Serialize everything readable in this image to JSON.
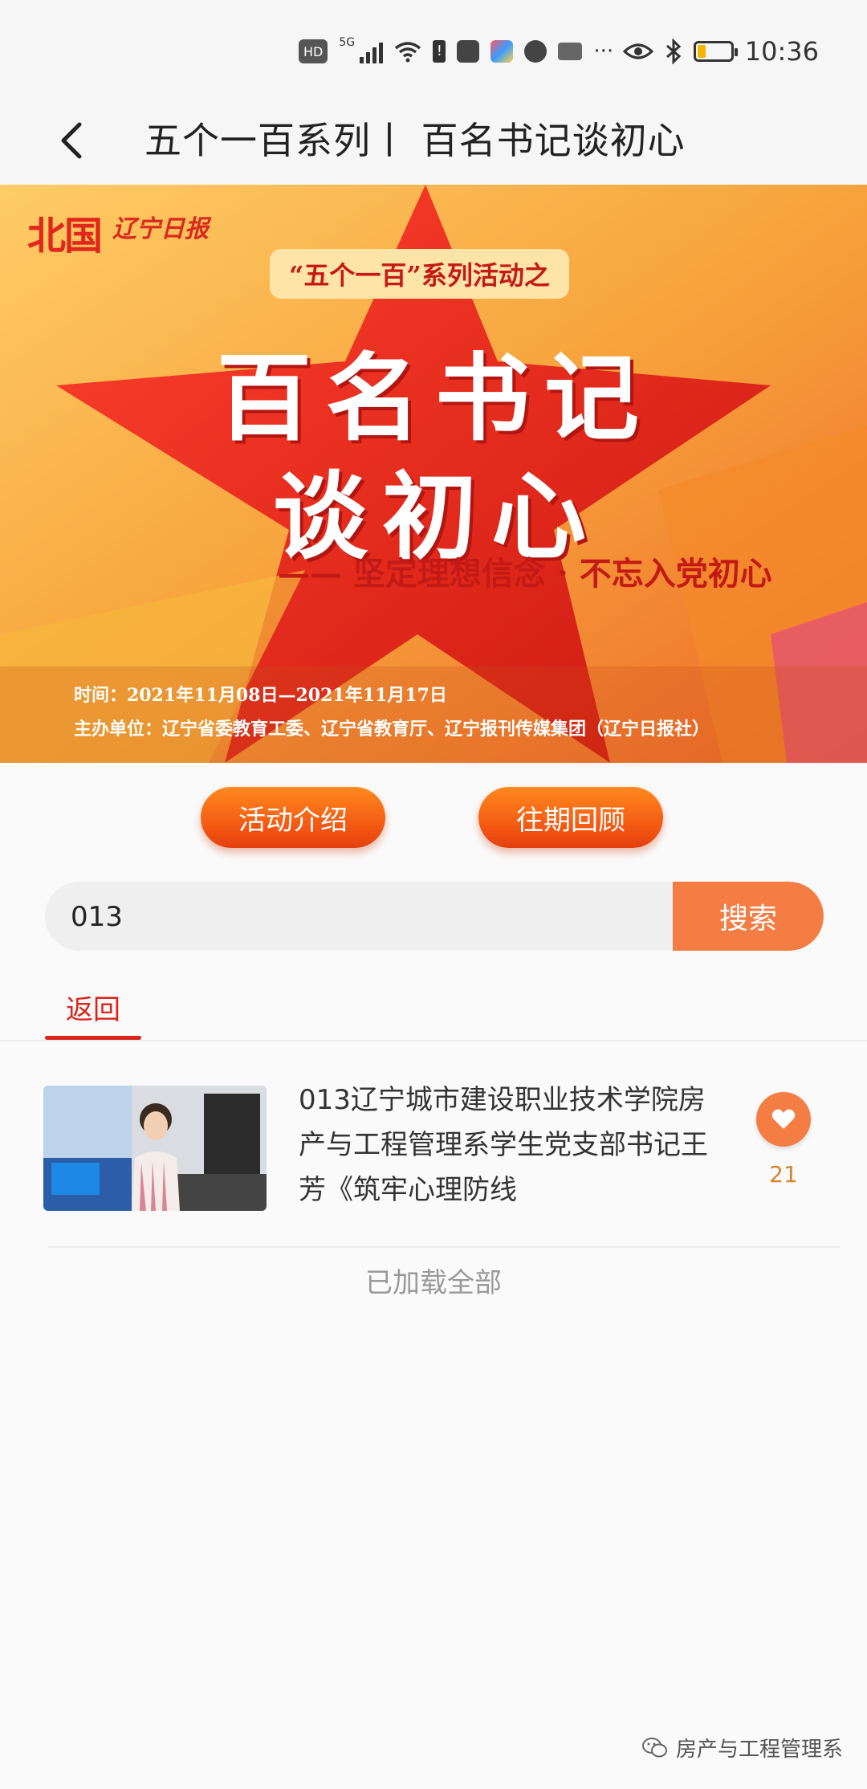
{
  "status_bar": {
    "network_label": "HD",
    "signal_label": "5G",
    "time": "10:36",
    "battery_level": 0.25
  },
  "header": {
    "title": "五个一百系列丨 百名书记谈初心"
  },
  "banner": {
    "brand": "北国",
    "brand_sub": "辽宁日报",
    "subtitle": "“五个一百”系列活动之",
    "title_line1": "百名书记",
    "title_line2": "谈初心",
    "slogan": "—— 坚定理想信念 · 不忘入党初心",
    "time": "时间：2021年11月08日—2021年11月17日",
    "organizer": "主办单位：辽宁省委教育工委、辽宁省教育厅、辽宁报刊传媒集团（辽宁日报社）"
  },
  "buttons": {
    "intro": "活动介绍",
    "review": "往期回顾"
  },
  "search": {
    "value": "013",
    "button_label": "搜索"
  },
  "tabs": [
    {
      "label": "返回"
    }
  ],
  "results": [
    {
      "title": "013辽宁城市建设职业技术学院房产与工程管理系学生党支部书记王芳《筑牢心理防线",
      "likes": "21"
    }
  ],
  "footer": {
    "loaded_all": "已加载全部"
  },
  "watermark": {
    "text": "房产与工程管理系"
  },
  "colors": {
    "accent_red": "#d8261d",
    "button_orange": "#f47d44",
    "banner_red": "#e1261c"
  }
}
